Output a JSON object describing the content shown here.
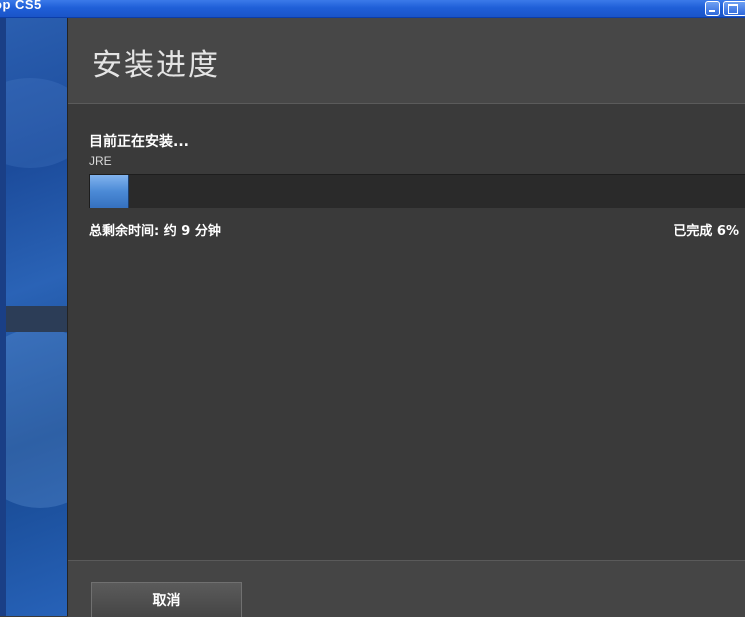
{
  "window": {
    "title": "op CS5"
  },
  "header": {
    "title": "安装进度"
  },
  "install": {
    "status_label": "目前正在安装...",
    "component": "JRE",
    "progress_fraction": 0.06,
    "time_remaining": "总剩余时间: 约 9 分钟",
    "completed": "已完成 6%"
  },
  "footer": {
    "cancel_label": "取消"
  },
  "colors": {
    "titlebar": "#1f5fd8",
    "panel": "#3a3a3a",
    "progress_fill": "#4b8ad6"
  }
}
